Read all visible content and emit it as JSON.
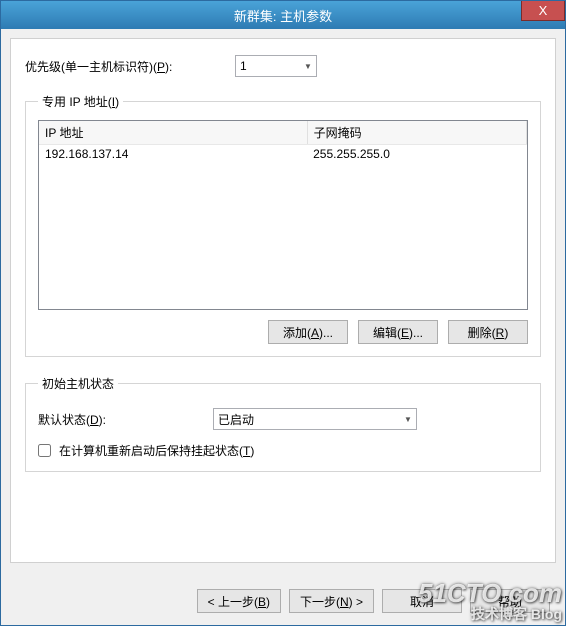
{
  "window": {
    "title": "新群集: 主机参数",
    "close_x": "X"
  },
  "priority": {
    "label_before": "优先级(单一主机标识符)(",
    "hotkey": "P",
    "label_after": "):",
    "value": "1"
  },
  "ipGroup": {
    "legend_before": "专用 IP 地址(",
    "legend_hotkey": "I",
    "legend_after": ")",
    "columns": {
      "ip": "IP 地址",
      "mask": "子网掩码"
    },
    "rows": [
      {
        "ip": "192.168.137.14",
        "mask": "255.255.255.0"
      }
    ],
    "buttons": {
      "add_before": "添加(",
      "add_hotkey": "A",
      "add_after": ")...",
      "edit_before": "编辑(",
      "edit_hotkey": "E",
      "edit_after": ")...",
      "remove_before": "删除(",
      "remove_hotkey": "R",
      "remove_after": ")"
    }
  },
  "stateGroup": {
    "legend": "初始主机状态",
    "default_before": "默认状态(",
    "default_hotkey": "D",
    "default_after": "):",
    "default_value": "已启动",
    "retain_before": "在计算机重新启动后保持挂起状态(",
    "retain_hotkey": "T",
    "retain_after": ")"
  },
  "nav": {
    "back_before": "< 上一步(",
    "back_hotkey": "B",
    "back_after": ")",
    "next_before": "下一步(",
    "next_hotkey": "N",
    "next_after": ") >",
    "cancel": "取消",
    "help": "帮助"
  },
  "watermark": {
    "line1": "51CTO.com",
    "line2": "技术博客 Blog"
  }
}
